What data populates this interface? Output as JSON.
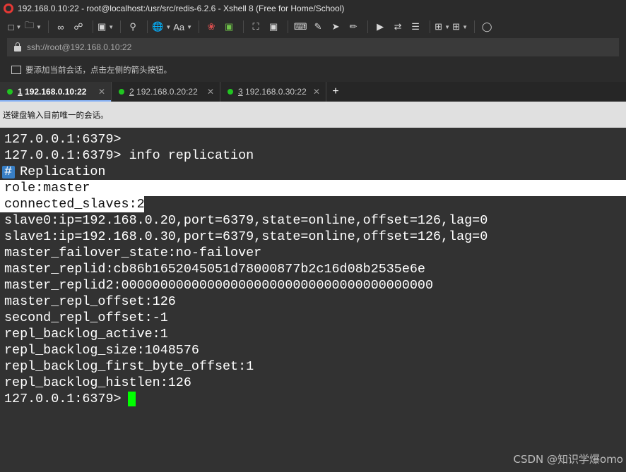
{
  "window": {
    "title": "192.168.0.10:22 - root@localhost:/usr/src/redis-6.2.6 - Xshell 8 (Free for Home/School)"
  },
  "toolbar": {
    "font_label": "Aa"
  },
  "address": {
    "value": "ssh://root@192.168.0.10:22"
  },
  "hint": {
    "text": "要添加当前会话，点击左侧的箭头按钮。"
  },
  "tabs": [
    {
      "num": "1",
      "label": "192.168.0.10:22",
      "active": true
    },
    {
      "num": "2",
      "label": "192.168.0.20:22",
      "active": false
    },
    {
      "num": "3",
      "label": "192.168.0.30:22",
      "active": false
    }
  ],
  "sendbar": {
    "text": "送键盘输入目前唯一的会话。"
  },
  "terminal": {
    "lines": [
      "127.0.0.1:6379>",
      "127.0.0.1:6379> info replication",
      "# Replication",
      "role:master",
      "connected_slaves:2",
      "slave0:ip=192.168.0.20,port=6379,state=online,offset=126,lag=0",
      "slave1:ip=192.168.0.30,port=6379,state=online,offset=126,lag=0",
      "master_failover_state:no-failover",
      "master_replid:cb86b1652045051d78000877b2c16d08b2535e6e",
      "master_replid2:0000000000000000000000000000000000000000",
      "master_repl_offset:126",
      "second_repl_offset:-1",
      "repl_backlog_active:1",
      "repl_backlog_size:1048576",
      "repl_backlog_first_byte_offset:1",
      "repl_backlog_histlen:126",
      "127.0.0.1:6379> "
    ]
  },
  "watermark": {
    "text": "CSDN @知识学爆omo"
  },
  "colors": {
    "cursor": "#00ff00",
    "active_dot": "#21c521"
  }
}
